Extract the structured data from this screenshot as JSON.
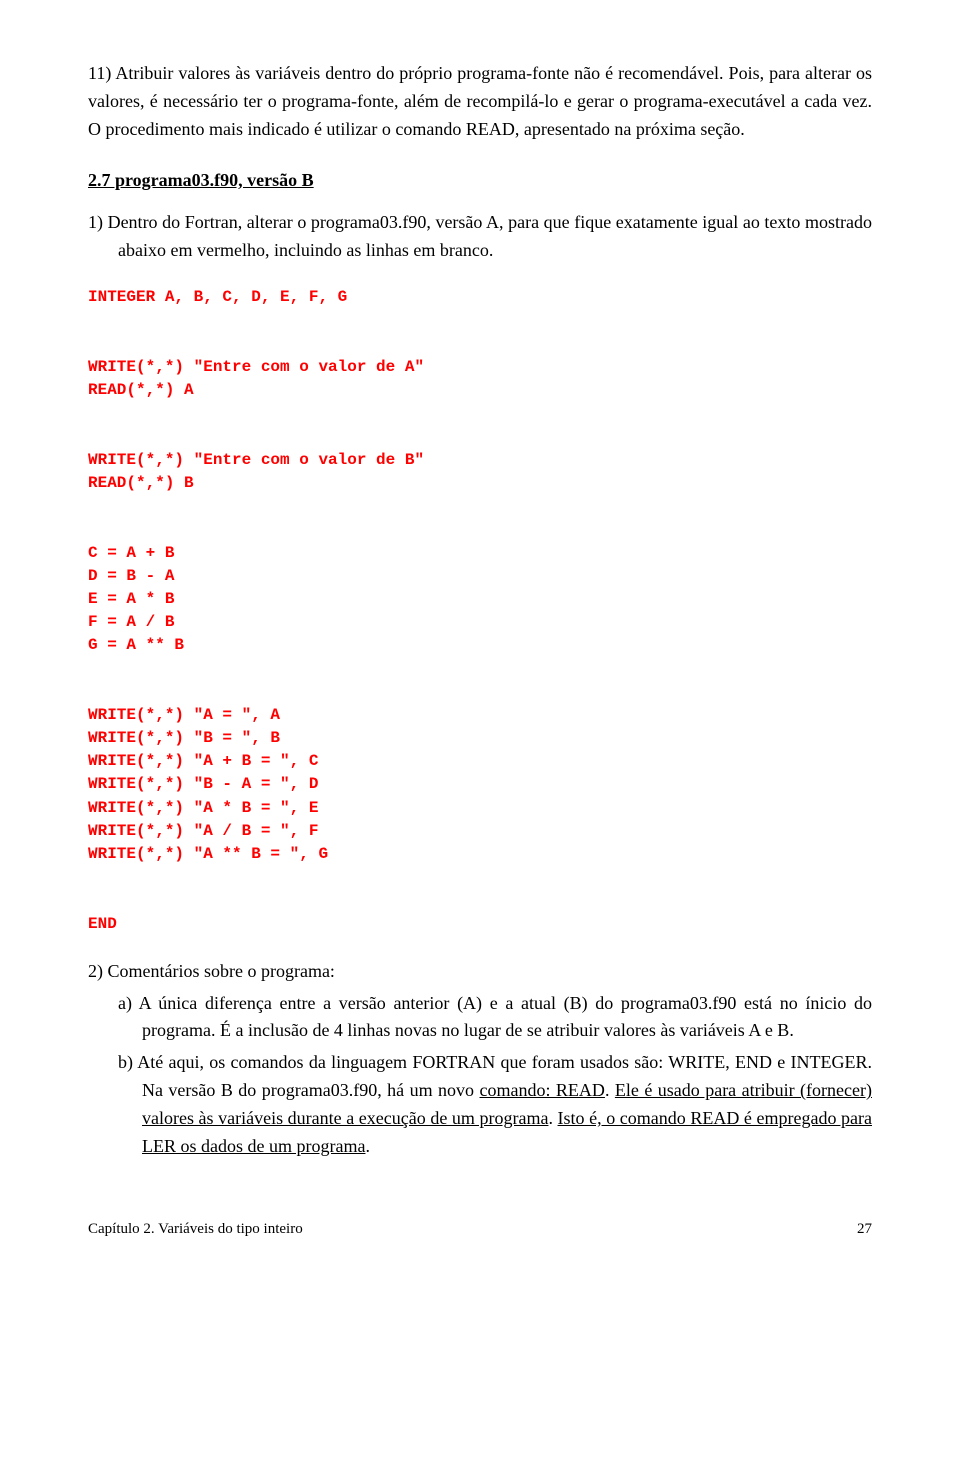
{
  "para1": "11) Atribuir valores às variáveis dentro do próprio programa-fonte não é recomendável. Pois, para alterar os valores, é necessário ter o programa-fonte, além de recompilá-lo e gerar o programa-executável a cada vez. O procedimento mais indicado é utilizar o comando READ, apresentado na próxima seção.",
  "section_title": "2.7 programa03.f90, versão B",
  "item1": "1)  Dentro do Fortran, alterar o programa03.f90, versão A, para que fique exatamente igual ao texto mostrado abaixo em vermelho, incluindo as linhas em branco.",
  "code": "INTEGER A, B, C, D, E, F, G\n\n\nWRITE(*,*) \"Entre com o valor de A\"\nREAD(*,*) A\n\n\nWRITE(*,*) \"Entre com o valor de B\"\nREAD(*,*) B\n\n\nC = A + B\nD = B - A\nE = A * B\nF = A / B\nG = A ** B\n\n\nWRITE(*,*) \"A = \", A\nWRITE(*,*) \"B = \", B\nWRITE(*,*) \"A + B = \", C\nWRITE(*,*) \"B - A = \", D\nWRITE(*,*) \"A * B = \", E\nWRITE(*,*) \"A / B = \", F\nWRITE(*,*) \"A ** B = \", G\n\n\nEND",
  "item2": "2)  Comentários sobre o programa:",
  "sub_a": "a) A única diferença entre a versão anterior (A) e a atual (B) do programa03.f90 está no ínicio do programa. É a inclusão de 4 linhas novas no lugar de se atribuir valores às variáveis A e B.",
  "sub_b_pre": "b) Até aqui, os comandos da linguagem FORTRAN que foram usados são: WRITE, END e INTEGER. Na versão B do programa03.f90, há um novo ",
  "sub_b_u1": "comando: READ",
  "sub_b_mid1": ". ",
  "sub_b_u2": "Ele é usado para atribuir (fornecer) valores às variáveis durante a execução de um programa",
  "sub_b_mid2": ". ",
  "sub_b_u3": "Isto é, o comando READ é empregado para LER os dados de um programa",
  "sub_b_end": ".",
  "footer_left": "Capítulo 2. Variáveis do tipo inteiro",
  "footer_right": "27"
}
